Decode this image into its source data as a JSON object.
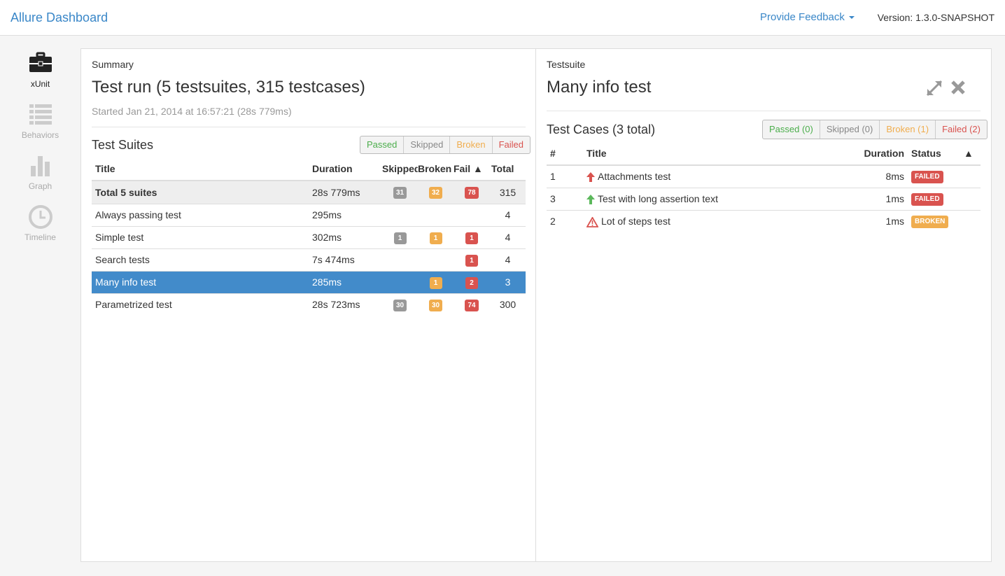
{
  "nav": {
    "brand": "Allure Dashboard",
    "feedback_label": "Provide Feedback",
    "version": "Version: 1.3.0-SNAPSHOT"
  },
  "sidebar": {
    "items": [
      {
        "label": "xUnit",
        "icon": "briefcase-icon",
        "active": true
      },
      {
        "label": "Behaviors",
        "icon": "list-icon",
        "active": false
      },
      {
        "label": "Graph",
        "icon": "bar-chart-icon",
        "active": false
      },
      {
        "label": "Timeline",
        "icon": "clock-icon",
        "active": false
      }
    ]
  },
  "summary": {
    "heading": "Summary",
    "title": "Test run (5 testsuites, 315 testcases)",
    "started": "Started Jan 21, 2014 at 16:57:21 (28s 779ms)",
    "suites_title": "Test Suites",
    "filters": [
      "Passed",
      "Skipped",
      "Broken",
      "Failed"
    ],
    "columns": [
      "Title",
      "Duration",
      "Skipped",
      "Broken",
      "Fail ▲",
      "Total"
    ],
    "total_row": {
      "title": "Total 5 suites",
      "duration": "28s 779ms",
      "skipped": "31",
      "broken": "32",
      "failed": "78",
      "total": "315"
    },
    "rows": [
      {
        "title": "Always passing test",
        "duration": "295ms",
        "skipped": "",
        "broken": "",
        "failed": "",
        "total": "4"
      },
      {
        "title": "Simple test",
        "duration": "302ms",
        "skipped": "1",
        "broken": "1",
        "failed": "1",
        "total": "4"
      },
      {
        "title": "Search tests",
        "duration": "7s 474ms",
        "skipped": "",
        "broken": "",
        "failed": "1",
        "total": "4"
      },
      {
        "title": "Many info test",
        "duration": "285ms",
        "skipped": "",
        "broken": "1",
        "failed": "2",
        "total": "3",
        "selected": true
      },
      {
        "title": "Parametrized test",
        "duration": "28s 723ms",
        "skipped": "30",
        "broken": "30",
        "failed": "74",
        "total": "300"
      }
    ]
  },
  "testsuite": {
    "heading": "Testsuite",
    "title": "Many info test",
    "cases_title": "Test Cases (3 total)",
    "filters": [
      "Passed (0)",
      "Skipped (0)",
      "Broken (1)",
      "Failed (2)"
    ],
    "columns": [
      "#",
      "Title",
      "Duration",
      "Status",
      "▲"
    ],
    "rows": [
      {
        "num": "1",
        "icon": "arrow-up-red-icon",
        "title": "Attachments test",
        "duration": "8ms",
        "status": "FAILED"
      },
      {
        "num": "3",
        "icon": "arrow-up-green-icon",
        "title": "Test with long assertion text",
        "duration": "1ms",
        "status": "FAILED"
      },
      {
        "num": "2",
        "icon": "warning-icon",
        "title": "Lot of steps test",
        "duration": "1ms",
        "status": "BROKEN"
      }
    ]
  },
  "colors": {
    "link": "#3a87c8",
    "passed": "#4cae4c",
    "skipped": "#999999",
    "broken": "#f0ad4e",
    "failed": "#d9534f",
    "selected_row": "#428bca"
  }
}
